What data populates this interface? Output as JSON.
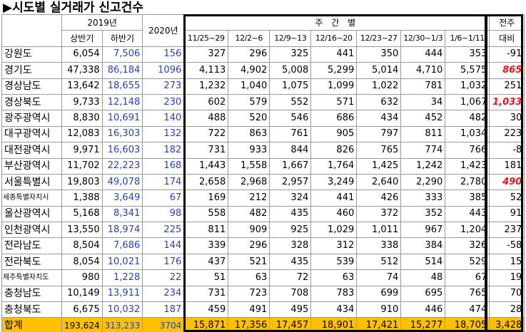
{
  "title": "▶시도별 실거래가 신고건수",
  "header": {
    "year_2019": "2019년",
    "first_half": "상반기",
    "second_half": "하반기",
    "year_2020": "2020년",
    "weekly": "주 간 별",
    "weeks": [
      "11/25~29",
      "12/2~6",
      "12/9~13",
      "12/16~20",
      "12/23~27",
      "12/30~1/3",
      "1/6~1/11"
    ],
    "prev_week_line1": "전주",
    "prev_week_line2": "대비"
  },
  "rows": [
    {
      "name": "강원도",
      "h1": "6,054",
      "h2": "7,506",
      "y2020": "156",
      "w": [
        "327",
        "296",
        "325",
        "441",
        "350",
        "444",
        "353"
      ],
      "diff": "-91",
      "highlight": false
    },
    {
      "name": "경기도",
      "h1": "47,338",
      "h2": "86,184",
      "y2020": "1096",
      "w": [
        "4,113",
        "4,902",
        "5,008",
        "5,299",
        "5,014",
        "4,710",
        "5,575"
      ],
      "diff": "865",
      "highlight": true
    },
    {
      "name": "경상남도",
      "h1": "13,642",
      "h2": "18,655",
      "y2020": "273",
      "w": [
        "1,232",
        "1,040",
        "1,075",
        "1,099",
        "1,022",
        "781",
        "1,032"
      ],
      "diff": "251",
      "highlight": false
    },
    {
      "name": "경상북도",
      "h1": "9,733",
      "h2": "12,148",
      "y2020": "230",
      "w": [
        "602",
        "579",
        "552",
        "571",
        "632",
        "34",
        "1,067"
      ],
      "diff": "1,033",
      "highlight": true
    },
    {
      "name": "광주광역시",
      "h1": "8,830",
      "h2": "10,691",
      "y2020": "140",
      "w": [
        "488",
        "520",
        "546",
        "686",
        "434",
        "452",
        "482"
      ],
      "diff": "30",
      "highlight": false
    },
    {
      "name": "대구광역시",
      "h1": "12,083",
      "h2": "16,303",
      "y2020": "132",
      "w": [
        "722",
        "863",
        "761",
        "905",
        "797",
        "811",
        "1,034"
      ],
      "diff": "223",
      "highlight": false
    },
    {
      "name": "대전광역시",
      "h1": "9,971",
      "h2": "16,603",
      "y2020": "182",
      "w": [
        "731",
        "933",
        "844",
        "826",
        "765",
        "774",
        "766"
      ],
      "diff": "-8",
      "highlight": false
    },
    {
      "name": "부산광역시",
      "h1": "11,702",
      "h2": "22,223",
      "y2020": "168",
      "w": [
        "1,443",
        "1,558",
        "1,667",
        "1,764",
        "1,425",
        "1,242",
        "1,423"
      ],
      "diff": "181",
      "highlight": false
    },
    {
      "name": "서울특별시",
      "h1": "19,803",
      "h2": "49,078",
      "y2020": "174",
      "w": [
        "2,658",
        "2,968",
        "2,957",
        "3,249",
        "2,640",
        "2,290",
        "2,780"
      ],
      "diff": "490",
      "highlight": true
    },
    {
      "name": "세종특별자치시",
      "h1": "1,388",
      "h2": "3,649",
      "y2020": "67",
      "w": [
        "169",
        "212",
        "324",
        "441",
        "426",
        "333",
        "385"
      ],
      "diff": "52",
      "highlight": false,
      "small": true
    },
    {
      "name": "울산광역시",
      "h1": "5,168",
      "h2": "8,341",
      "y2020": "98",
      "w": [
        "558",
        "482",
        "435",
        "460",
        "372",
        "352",
        "443"
      ],
      "diff": "91",
      "highlight": false
    },
    {
      "name": "인천광역시",
      "h1": "13,550",
      "h2": "18,974",
      "y2020": "225",
      "w": [
        "811",
        "909",
        "925",
        "1,029",
        "1,011",
        "967",
        "1,204"
      ],
      "diff": "237",
      "highlight": false
    },
    {
      "name": "전라남도",
      "h1": "8,504",
      "h2": "7,686",
      "y2020": "144",
      "w": [
        "339",
        "296",
        "328",
        "312",
        "338",
        "384",
        "326"
      ],
      "diff": "-58",
      "highlight": false
    },
    {
      "name": "전라북도",
      "h1": "8,054",
      "h2": "10,021",
      "y2020": "176",
      "w": [
        "437",
        "521",
        "435",
        "539",
        "512",
        "514",
        "529"
      ],
      "diff": "15",
      "highlight": false
    },
    {
      "name": "제주특별자치도",
      "h1": "980",
      "h2": "1,228",
      "y2020": "22",
      "w": [
        "51",
        "63",
        "72",
        "63",
        "74",
        "48",
        "67"
      ],
      "diff": "19",
      "highlight": false,
      "small": true
    },
    {
      "name": "충청남도",
      "h1": "10,149",
      "h2": "13,911",
      "y2020": "234",
      "w": [
        "731",
        "723",
        "708",
        "783",
        "699",
        "695",
        "765"
      ],
      "diff": "70",
      "highlight": false
    },
    {
      "name": "충청북도",
      "h1": "6,675",
      "h2": "10,032",
      "y2020": "187",
      "w": [
        "459",
        "491",
        "495",
        "434",
        "910",
        "446",
        "474"
      ],
      "diff": "28",
      "highlight": false
    }
  ],
  "total": {
    "name": "합계",
    "h1": "193,624",
    "h2": "313,233",
    "y2020": "3704",
    "w": [
      "15,871",
      "17,356",
      "17,457",
      "18,901",
      "17,421",
      "15,277",
      "18,705"
    ],
    "diff": "3,428"
  },
  "colors": {
    "total_bg": "#ffc000",
    "second_half_text": "#1f3fd1",
    "highlight_text": "#e8141c"
  }
}
